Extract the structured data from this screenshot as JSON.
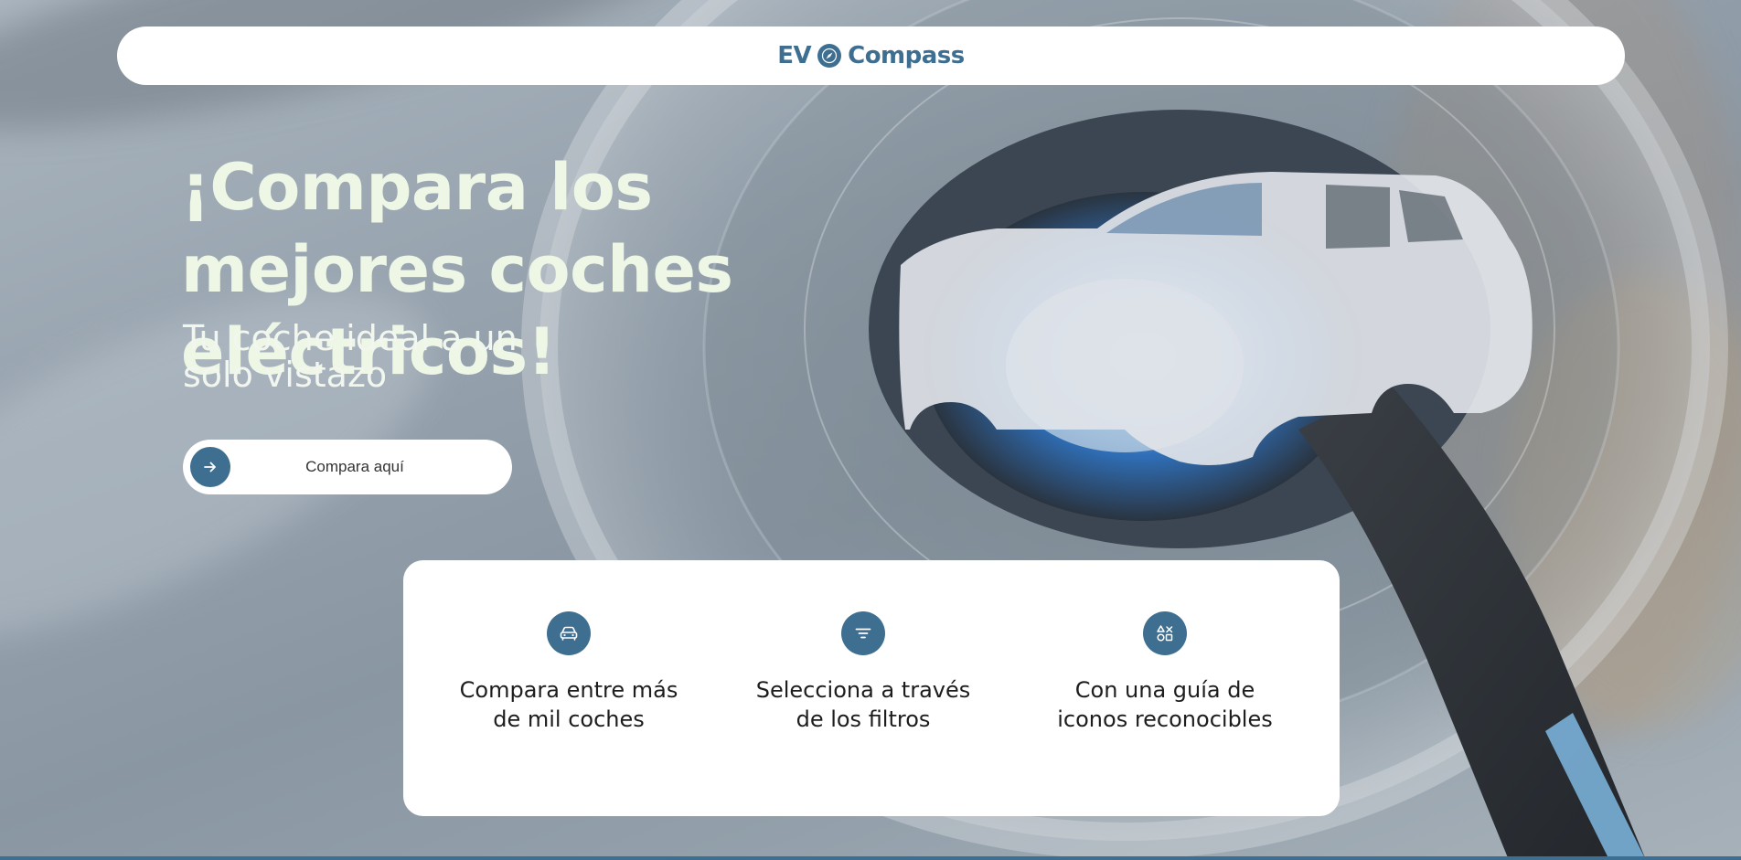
{
  "brand": {
    "left": "EV",
    "right": "Compass",
    "logo_icon": "compass-icon",
    "color": "#3e6f90"
  },
  "hero": {
    "title": "¡Compara los mejores coches eléctricos!",
    "subtitle": "Tu coche ideal a un solo vistazo",
    "cta_label": "Compara aquí",
    "cta_icon": "arrow-right-icon"
  },
  "features": [
    {
      "icon": "car-icon",
      "text": "Compara entre más de mil coches"
    },
    {
      "icon": "filter-icon",
      "text": "Selecciona a través de los filtros"
    },
    {
      "icon": "shapes-icon",
      "text": "Con una guía de iconos reconocibles"
    }
  ],
  "colors": {
    "accent": "#3e6f90",
    "hero_text": "#eef6e6"
  }
}
